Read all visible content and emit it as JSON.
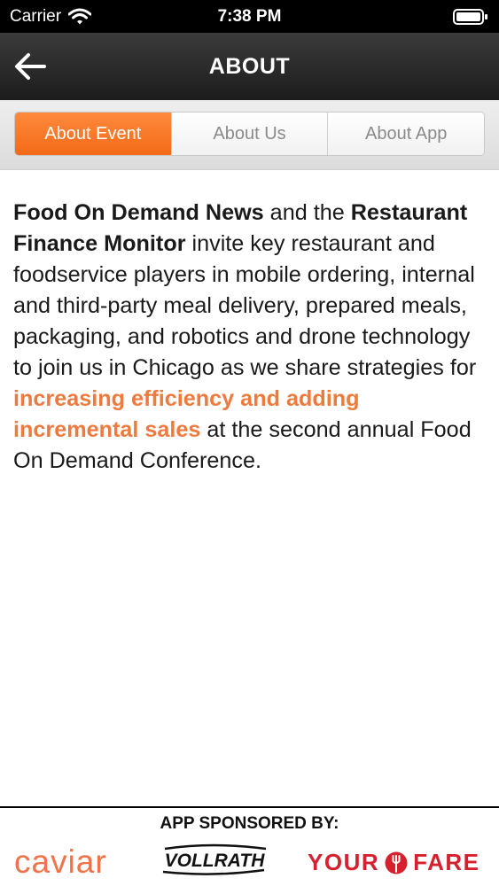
{
  "status_bar": {
    "carrier": "Carrier",
    "time": "7:38 PM"
  },
  "nav": {
    "title": "ABOUT"
  },
  "tabs": [
    {
      "label": "About Event",
      "active": true
    },
    {
      "label": "About Us",
      "active": false
    },
    {
      "label": "About App",
      "active": false
    }
  ],
  "content": {
    "part1": "Food On Demand News",
    "part2": " and the ",
    "part3": "Restaurant Finance Monitor",
    "part4": " invite key restaurant and foodservice players in mobile ordering, internal and third-party meal delivery, prepared meals, packaging, and robotics and drone technology to join us in Chicago as we share strategies for ",
    "part5": "increasing efficiency and adding incremental sales",
    "part6": " at the second annual Food On Demand Conference."
  },
  "sponsors": {
    "title": "APP SPONSORED BY:",
    "caviar": "caviar",
    "vollrath": "VOLLRATH",
    "yourfare_left": "YOUR",
    "yourfare_right": "FARE"
  },
  "colors": {
    "accent_orange": "#f26a18",
    "highlight_orange": "#ee7a3d",
    "caviar": "#f0734a",
    "yourfare_red": "#d6202e"
  }
}
